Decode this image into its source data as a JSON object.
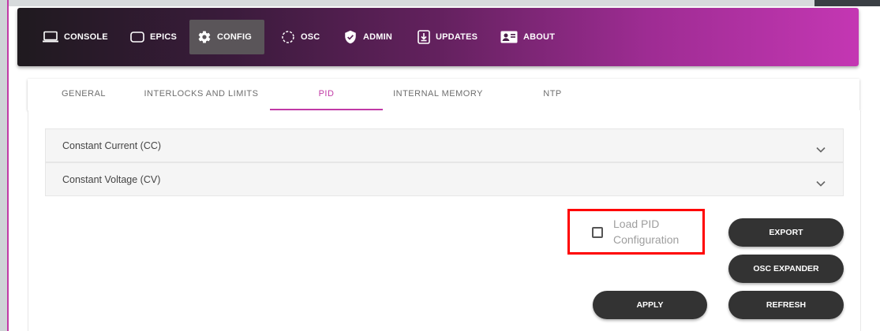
{
  "nav": {
    "items": [
      {
        "label": "CONSOLE",
        "icon": "monitor-icon"
      },
      {
        "label": "EPICS",
        "icon": "rounded-rect-icon"
      },
      {
        "label": "CONFIG",
        "icon": "gear-icon"
      },
      {
        "label": "OSC",
        "icon": "dotted-circle-icon"
      },
      {
        "label": "ADMIN",
        "icon": "shield-check-icon"
      },
      {
        "label": "UPDATES",
        "icon": "download-box-icon"
      },
      {
        "label": "ABOUT",
        "icon": "contact-card-icon"
      }
    ],
    "active": "CONFIG"
  },
  "tabs": {
    "items": [
      "GENERAL",
      "INTERLOCKS AND LIMITS",
      "PID",
      "INTERNAL MEMORY",
      "NTP"
    ],
    "active": "PID"
  },
  "panels": [
    {
      "title": "Constant Current (CC)"
    },
    {
      "title": "Constant Voltage (CV)"
    }
  ],
  "load_pid": {
    "label_line1": "Load PID",
    "label_line2": "Configuration",
    "checked": false
  },
  "buttons": {
    "export": "EXPORT",
    "osc_expander": "OSC EXPANDER",
    "apply": "APPLY",
    "refresh": "REFRESH"
  },
  "colors": {
    "accent": "#c13aa6",
    "button_bg": "#333333",
    "highlight": "#ff0000"
  }
}
